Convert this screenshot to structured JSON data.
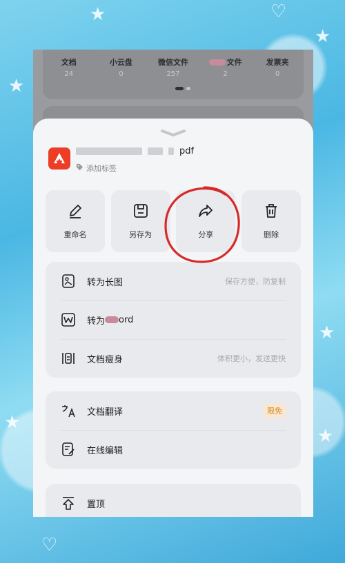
{
  "stats": [
    {
      "label": "文档",
      "value": "24"
    },
    {
      "label": "小云盘",
      "value": "0"
    },
    {
      "label": "微信文件",
      "value": "257"
    },
    {
      "label": "文件",
      "value": "2"
    },
    {
      "label": "发票夹",
      "value": "0"
    }
  ],
  "file": {
    "name_suffix": "pdf",
    "tag_label": "添加标签",
    "icon": "pdf-icon"
  },
  "actions": [
    {
      "label": "重命名",
      "icon": "pencil-icon"
    },
    {
      "label": "另存为",
      "icon": "save-icon"
    },
    {
      "label": "分享",
      "icon": "share-icon"
    },
    {
      "label": "删除",
      "icon": "trash-icon"
    }
  ],
  "list_group1": [
    {
      "label": "转为长图",
      "hint": "保存方便，防复制",
      "icon": "long-image-icon"
    },
    {
      "label": "转为",
      "label_tail": "ord",
      "icon": "word-icon"
    },
    {
      "label": "文档瘦身",
      "hint": "体积更小，发送更快",
      "icon": "compress-icon"
    }
  ],
  "list_group2": [
    {
      "label": "文档翻译",
      "badge": "限免",
      "icon": "translate-icon"
    },
    {
      "label": "在线编辑",
      "icon": "edit-doc-icon"
    }
  ],
  "list_group3": [
    {
      "label": "置顶",
      "icon": "pin-top-icon"
    }
  ],
  "colors": {
    "pdf_red": "#ee3d27",
    "annotation_red": "#d62a2a",
    "badge_text": "#d08a2a",
    "badge_bg": "#fbe7cf"
  }
}
